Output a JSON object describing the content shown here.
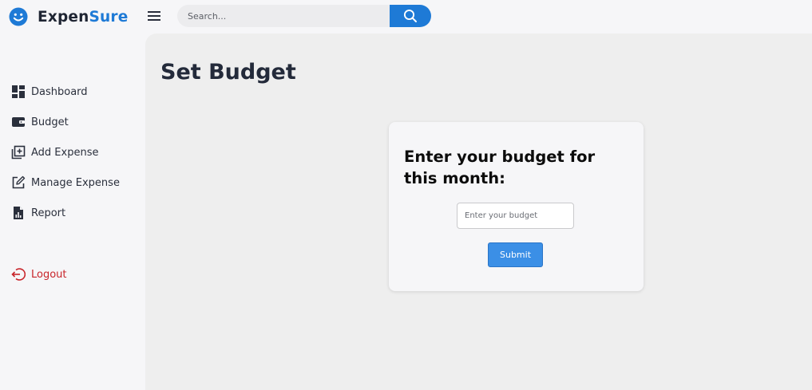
{
  "app": {
    "name_part1": "Expen",
    "name_part2": "Sure",
    "logo_icon": "smiley-face-icon"
  },
  "header": {
    "menu_icon": "hamburger-menu-icon",
    "search": {
      "placeholder": "Search...",
      "value": "",
      "button_icon": "search-icon"
    }
  },
  "sidebar": {
    "items": [
      {
        "label": "Dashboard",
        "icon": "dashboard-grid-icon"
      },
      {
        "label": "Budget",
        "icon": "wallet-icon"
      },
      {
        "label": "Add Expense",
        "icon": "add-box-icon"
      },
      {
        "label": "Manage Expense",
        "icon": "edit-square-icon"
      },
      {
        "label": "Report",
        "icon": "report-document-icon"
      }
    ],
    "logout": {
      "label": "Logout",
      "icon": "logout-icon"
    }
  },
  "main": {
    "title": "Set Budget",
    "card": {
      "heading": "Enter your budget for this month:",
      "input_placeholder": "Enter your budget",
      "input_value": "",
      "submit_label": "Submit"
    }
  },
  "colors": {
    "brand_blue": "#1e7ad6",
    "submit_blue": "#3b8fe6",
    "logout_red": "#c8242a",
    "sidebar_bg": "#f6f6f8",
    "main_bg": "#eeeeee"
  }
}
